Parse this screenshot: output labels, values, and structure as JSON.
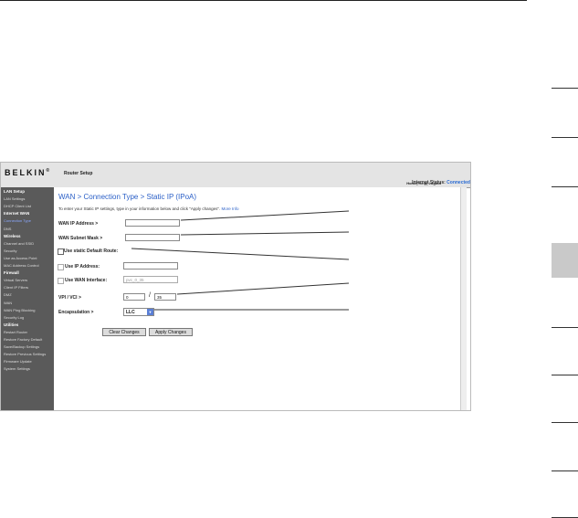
{
  "header": {
    "logo": "BELKIN",
    "logo_mark": "®",
    "router_setup": "Router Setup",
    "links": "Home| Help| Logout",
    "status_label": "Internet Status:",
    "status_value": "Connected"
  },
  "sidebar": [
    {
      "label": "LAN Setup",
      "type": "head"
    },
    {
      "label": "LAN Settings",
      "type": "item"
    },
    {
      "label": "DHCP Client List",
      "type": "item"
    },
    {
      "label": "Internet WAN",
      "type": "head"
    },
    {
      "label": "Connection Type",
      "type": "active"
    },
    {
      "label": "DNS",
      "type": "item"
    },
    {
      "label": "Wireless",
      "type": "head"
    },
    {
      "label": "Channel and SSID",
      "type": "item"
    },
    {
      "label": "Security",
      "type": "item"
    },
    {
      "label": "Use as Access Point",
      "type": "item"
    },
    {
      "label": "MAC Address Control",
      "type": "item"
    },
    {
      "label": "Firewall",
      "type": "head"
    },
    {
      "label": "Virtual Servers",
      "type": "item"
    },
    {
      "label": "Client IP Filters",
      "type": "item"
    },
    {
      "label": "DMZ",
      "type": "item"
    },
    {
      "label": "WAN",
      "type": "item"
    },
    {
      "label": "WAN Ping Blocking",
      "type": "item"
    },
    {
      "label": "Security Log",
      "type": "item"
    },
    {
      "label": "Utilities",
      "type": "head"
    },
    {
      "label": "Restart Router",
      "type": "item"
    },
    {
      "label": "Restore Factory Default",
      "type": "item"
    },
    {
      "label": "Save/Backup Settings",
      "type": "item"
    },
    {
      "label": "Restore Previous Settings",
      "type": "item"
    },
    {
      "label": "Firmware Update",
      "type": "item"
    },
    {
      "label": "System Settings",
      "type": "item"
    }
  ],
  "main": {
    "title": "WAN > Connection Type > Static IP (IPoA)",
    "intro": "To enter your Static IP settings, type in your information below and click \"Apply changes\".",
    "intro_link": "More Info",
    "wan_ip_label": "WAN IP Address >",
    "wan_ip_value": "",
    "wan_mask_label": "WAN Subnet Mask >",
    "wan_mask_value": "",
    "default_route_label": "Use static Default Route:",
    "ip_address_label": "Use IP Address:",
    "ip_address_value": "",
    "wan_interface_label": "Use WAN Interface:",
    "wan_interface_value": "pvc_0_35",
    "vpi_vci_label": "VPI / VCI >",
    "vpi": "0",
    "vci_sep": "/",
    "vci": "35",
    "encap_label": "Encapsulation >",
    "encap_value": "LLC",
    "clear_button": "Clear Changes",
    "apply_button": "Apply Changes"
  }
}
